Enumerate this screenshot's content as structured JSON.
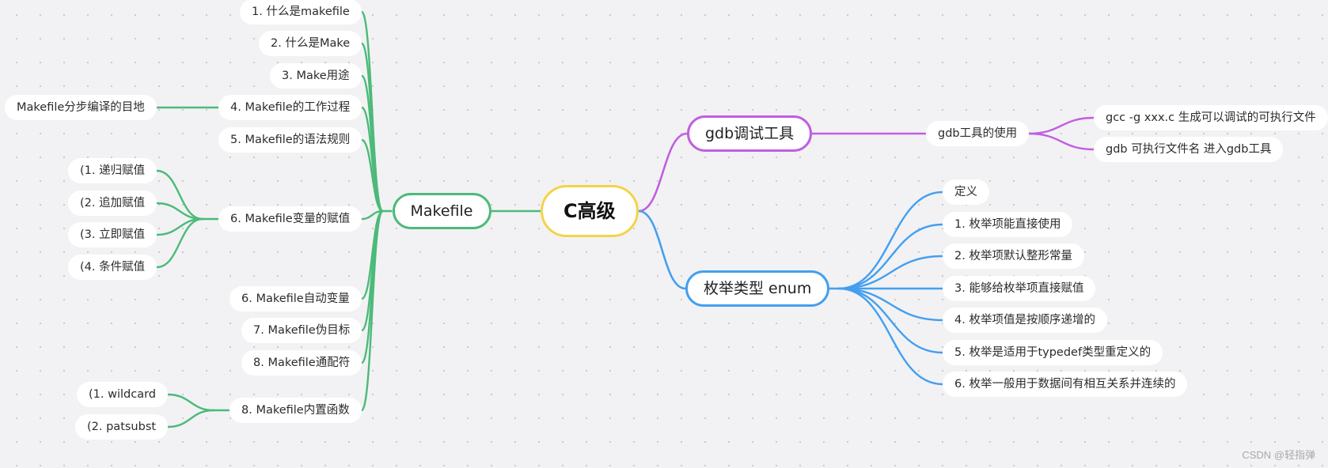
{
  "colors": {
    "makefile": "#4cba79",
    "gdb": "#c15ee0",
    "enum": "#439ff0",
    "root_border": "#f2d448"
  },
  "root": {
    "id": "root",
    "label": "C高级"
  },
  "branches": [
    {
      "id": "makefile",
      "label": "Makefile",
      "color_key": "makefile",
      "side": "left",
      "children": [
        {
          "id": "mk1",
          "label": "1. 什么是makefile"
        },
        {
          "id": "mk2",
          "label": "2. 什么是Make"
        },
        {
          "id": "mk3",
          "label": "3. Make用途"
        },
        {
          "id": "mk4",
          "label": "4. Makefile的工作过程",
          "children": [
            {
              "id": "mk4a",
              "label": "Makefile分步编译的目地"
            }
          ]
        },
        {
          "id": "mk5",
          "label": "5. Makefile的语法规则"
        },
        {
          "id": "mk6",
          "label": "6. Makefile变量的赋值",
          "children": [
            {
              "id": "mk6a",
              "label": "(1. 递归赋值"
            },
            {
              "id": "mk6b",
              "label": "(2. 追加赋值"
            },
            {
              "id": "mk6c",
              "label": "(3. 立即赋值"
            },
            {
              "id": "mk6d",
              "label": "(4. 条件赋值"
            }
          ]
        },
        {
          "id": "mk7",
          "label": "6. Makefile自动变量"
        },
        {
          "id": "mk8",
          "label": "7. Makefile伪目标"
        },
        {
          "id": "mk9",
          "label": "8. Makefile通配符"
        },
        {
          "id": "mk10",
          "label": "8. Makefile内置函数",
          "children": [
            {
              "id": "mk10a",
              "label": "(1. wildcard"
            },
            {
              "id": "mk10b",
              "label": "(2. patsubst"
            }
          ]
        }
      ]
    },
    {
      "id": "gdb",
      "label": "gdb调试工具",
      "color_key": "gdb",
      "side": "right",
      "children": [
        {
          "id": "gdb1",
          "label": "gdb工具的使用",
          "children": [
            {
              "id": "gdb1a",
              "label": "gcc -g xxx.c 生成可以调试的可执行文件"
            },
            {
              "id": "gdb1b",
              "label": "gdb 可执行文件名 进入gdb工具"
            }
          ]
        }
      ]
    },
    {
      "id": "enum",
      "label": "枚举类型 enum",
      "color_key": "enum",
      "side": "right",
      "children": [
        {
          "id": "en0",
          "label": "定义"
        },
        {
          "id": "en1",
          "label": "1. 枚举项能直接使用"
        },
        {
          "id": "en2",
          "label": "2. 枚举项默认整形常量"
        },
        {
          "id": "en3",
          "label": "3. 能够给枚举项直接赋值"
        },
        {
          "id": "en4",
          "label": "4. 枚举项值是按顺序递增的"
        },
        {
          "id": "en5",
          "label": "5. 枚举是适用于typedef类型重定义的"
        },
        {
          "id": "en6",
          "label": "6. 枚举一般用于数据间有相互关系并连续的"
        }
      ]
    }
  ],
  "watermark": "CSDN @轻指弹"
}
